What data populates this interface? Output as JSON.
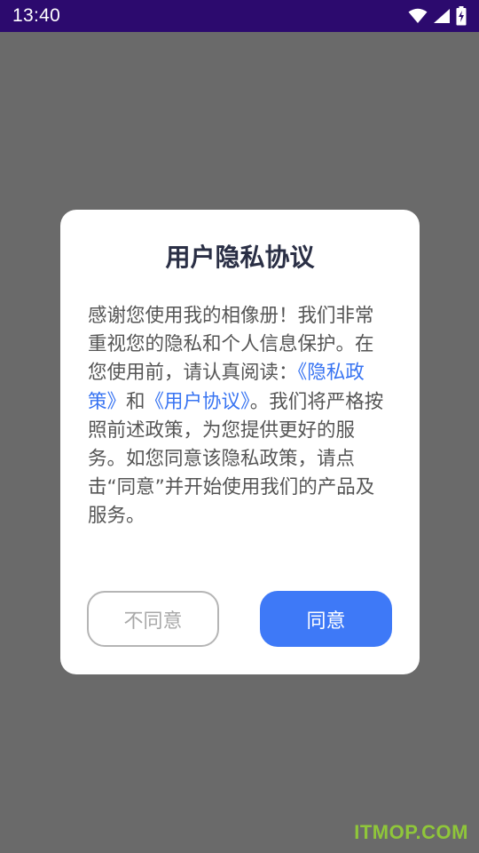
{
  "status_bar": {
    "time": "13:40",
    "icons": [
      "wifi-icon",
      "cellular-signal-icon",
      "battery-charging-icon"
    ],
    "background": "#2c0a6e"
  },
  "dialog": {
    "title": "用户隐私协议",
    "body": {
      "part1": "感谢您使用我的相像册！我们非常重视您的隐私和个人信息保护。在您使用前，请认真阅读：",
      "link_privacy": "《隐私政策》",
      "part2": "和",
      "link_agreement": "《用户协议》",
      "part3": "。我们将严格按照前述政策，为您提供更好的服务。如您同意该隐私政策，请点击“同意”并开始使用我们的产品及服务。"
    },
    "buttons": {
      "disagree": "不同意",
      "agree": "同意"
    },
    "colors": {
      "link": "#3874f2",
      "agree_button": "#3e79f7"
    }
  },
  "watermark": "ITMOP.COM"
}
